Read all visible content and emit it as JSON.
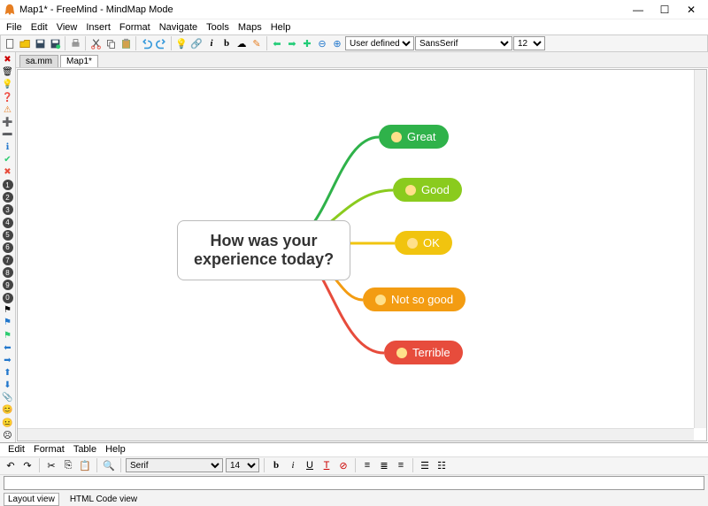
{
  "window": {
    "title": "Map1* - FreeMind - MindMap Mode"
  },
  "menus": {
    "file": "File",
    "edit": "Edit",
    "view": "View",
    "insert": "Insert",
    "format": "Format",
    "navigate": "Navigate",
    "tools": "Tools",
    "maps": "Maps",
    "help": "Help"
  },
  "toolbar": {
    "style_select": "User defined..",
    "font_select": "SansSerif",
    "size_select": "12"
  },
  "tabs": {
    "t0": "sa.mm",
    "t1": "Map1*"
  },
  "mindmap": {
    "root": {
      "line1": "How was your",
      "line2": "experience today?"
    },
    "n0": {
      "label": "Great",
      "color": "#2fb24a"
    },
    "n1": {
      "label": "Good",
      "color": "#8acb1e"
    },
    "n2": {
      "label": "OK",
      "color": "#f1c40f"
    },
    "n3": {
      "label": "Not so good",
      "color": "#f39c12"
    },
    "n4": {
      "label": "Terrible",
      "color": "#e74c3c"
    }
  },
  "bottom": {
    "menus": {
      "edit": "Edit",
      "format": "Format",
      "table": "Table",
      "help": "Help"
    },
    "font_select": "Serif",
    "size_select": "14",
    "input_value": "",
    "tabs": {
      "layout": "Layout view",
      "html": "HTML Code view"
    }
  }
}
